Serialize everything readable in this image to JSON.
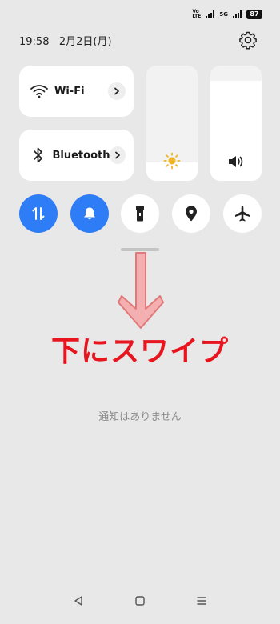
{
  "status": {
    "net_line1": "Vo",
    "net_line2": "LTE",
    "net_5g": "5G",
    "battery": "87"
  },
  "header": {
    "time": "19:58",
    "date": "2月2日(月)"
  },
  "tiles": {
    "wifi_label": "Wi-Fi",
    "bluetooth_label": "Bluetooth"
  },
  "sliders": {
    "brightness_level": 0.16,
    "volume_level": 0.87
  },
  "toggles": [
    {
      "name": "mobile-data",
      "icon": "data-arrows-icon",
      "on": true
    },
    {
      "name": "notification-sound",
      "icon": "bell-icon",
      "on": true
    },
    {
      "name": "flashlight",
      "icon": "flashlight-icon",
      "on": false
    },
    {
      "name": "location",
      "icon": "location-pin-icon",
      "on": false
    },
    {
      "name": "airplane-mode",
      "icon": "airplane-icon",
      "on": false
    }
  ],
  "colors": {
    "accent": "#2f7df6",
    "annotation": "#e8141e",
    "arrow": "#f0a0a0"
  },
  "annotation": {
    "text": "下にスワイプ"
  },
  "notifications": {
    "empty_text": "通知はありません"
  }
}
